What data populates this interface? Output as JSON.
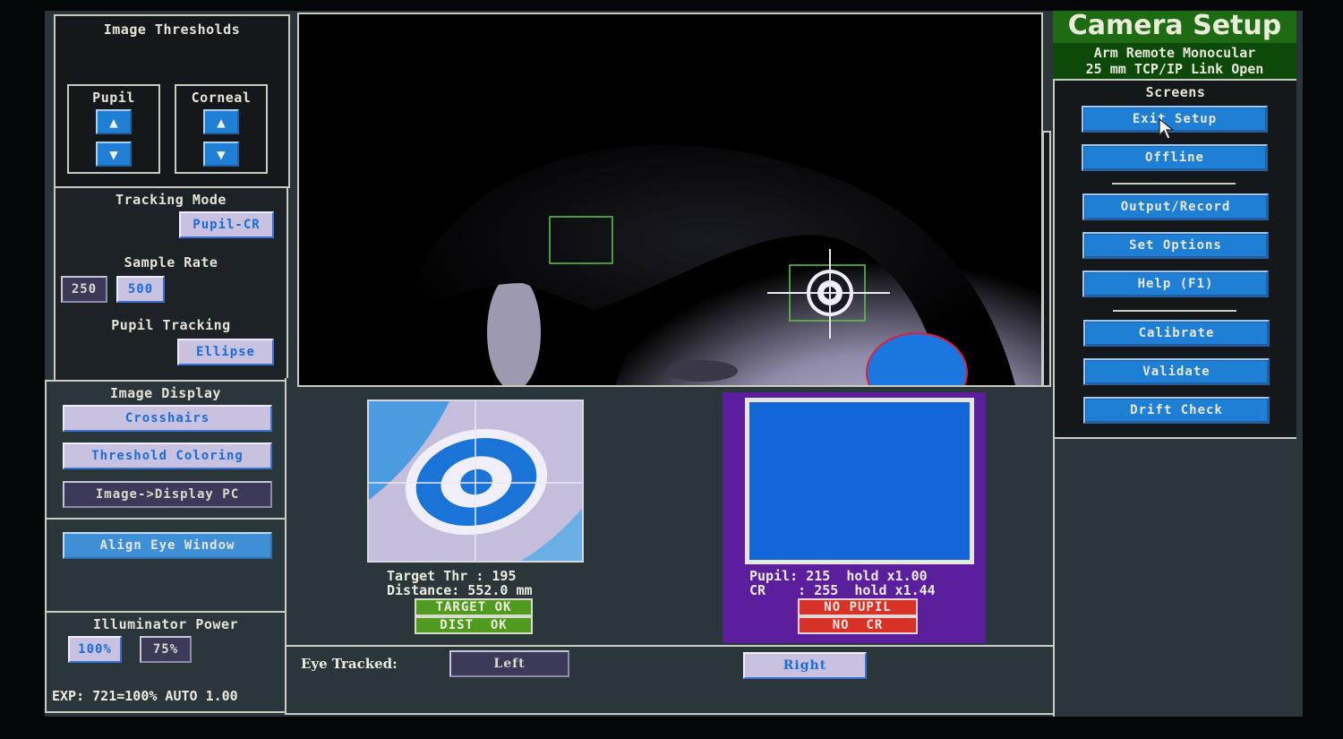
{
  "title": {
    "main": "Camera Setup",
    "line1": "Arm Remote Monocular",
    "line2": "25 mm TCP/IP Link Open"
  },
  "colors": {
    "title_green": "#1e6b14",
    "subtitle_green": "#0d4a0a",
    "button_blue": "#1f7fd4",
    "button_lavender": "#c8c2e0",
    "button_dim": "#3c3a58",
    "status_ok": "#4f9a1f",
    "status_error": "#d83228",
    "purple_panel": "#5b1f9e"
  },
  "thresholds": {
    "heading": "Image Thresholds",
    "pupil_label": "Pupil",
    "corneal_label": "Corneal",
    "up_icon": "▲",
    "down_icon": "▼"
  },
  "tracking_mode": {
    "heading": "Tracking Mode",
    "value": "Pupil-CR"
  },
  "sample_rate": {
    "heading": "Sample Rate",
    "options": [
      "250",
      "500"
    ],
    "selected": "500"
  },
  "pupil_tracking": {
    "heading": "Pupil Tracking",
    "value": "Ellipse"
  },
  "image_display": {
    "heading": "Image Display",
    "crosshairs": "Crosshairs",
    "threshold_coloring": "Threshold Coloring",
    "image_display_pc": "Image->Display PC"
  },
  "align": {
    "label": "Align Eye Window"
  },
  "illuminator": {
    "heading": "Illuminator Power",
    "options": [
      "100%",
      "75%"
    ],
    "selected": "100%",
    "exp_line": "EXP: 721=100% AUTO 1.00"
  },
  "target_info": {
    "line1": "Target Thr : 195",
    "line2": "Distance: 552.0 mm",
    "status1": "TARGET OK",
    "status2": "DIST  OK"
  },
  "eye_info": {
    "line1": "Pupil: 215  hold x1.00",
    "line2": "CR    : 255  hold x1.44",
    "status1": "NO PUPIL",
    "status2": "NO  CR"
  },
  "eye_tracked": {
    "label": "Eye Tracked:",
    "left": "Left",
    "right": "Right",
    "selected": "Right"
  },
  "screens": {
    "heading": "Screens",
    "group1": [
      "Exit Setup",
      "Offline"
    ],
    "group2": [
      "Output/Record",
      "Set Options",
      "Help (F1)"
    ],
    "group3": [
      "Calibrate",
      "Validate",
      "Drift Check"
    ]
  }
}
